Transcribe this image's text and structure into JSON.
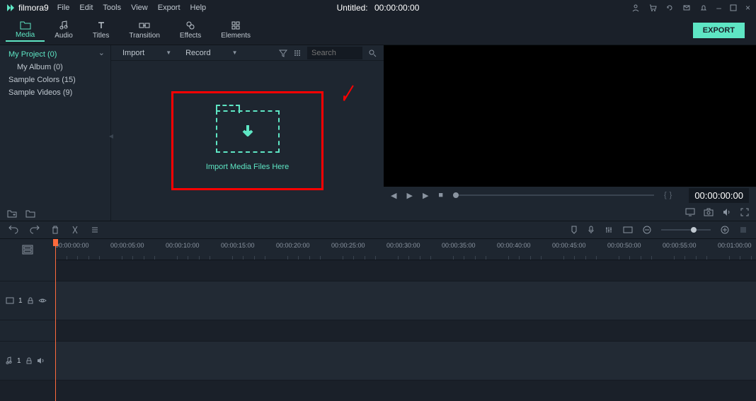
{
  "app": {
    "name": "filmora9",
    "title": "Untitled:",
    "timecode": "00:00:00:00"
  },
  "menu": [
    "File",
    "Edit",
    "Tools",
    "View",
    "Export",
    "Help"
  ],
  "tabs": [
    {
      "label": "Media",
      "icon": "folder"
    },
    {
      "label": "Audio",
      "icon": "music"
    },
    {
      "label": "Titles",
      "icon": "text"
    },
    {
      "label": "Transition",
      "icon": "transition"
    },
    {
      "label": "Effects",
      "icon": "effects"
    },
    {
      "label": "Elements",
      "icon": "elements"
    }
  ],
  "export_label": "EXPORT",
  "sidebar": {
    "items": [
      {
        "label": "My Project (0)",
        "active": true
      },
      {
        "label": "My Album (0)",
        "indent": true
      },
      {
        "label": "Sample Colors (15)"
      },
      {
        "label": "Sample Videos (9)"
      }
    ]
  },
  "media_toolbar": {
    "import": "Import",
    "record": "Record",
    "search_placeholder": "Search"
  },
  "import_zone_text": "Import Media Files Here",
  "preview_timecode": "00:00:00:00",
  "ruler_ticks": [
    "00:00:00:00",
    "00:00:05:00",
    "00:00:10:00",
    "00:00:15:00",
    "00:00:20:00",
    "00:00:25:00",
    "00:00:30:00",
    "00:00:35:00",
    "00:00:40:00",
    "00:00:45:00",
    "00:00:50:00",
    "00:00:55:00",
    "00:01:00:00"
  ],
  "tracks": {
    "video": "1",
    "audio": "1"
  }
}
